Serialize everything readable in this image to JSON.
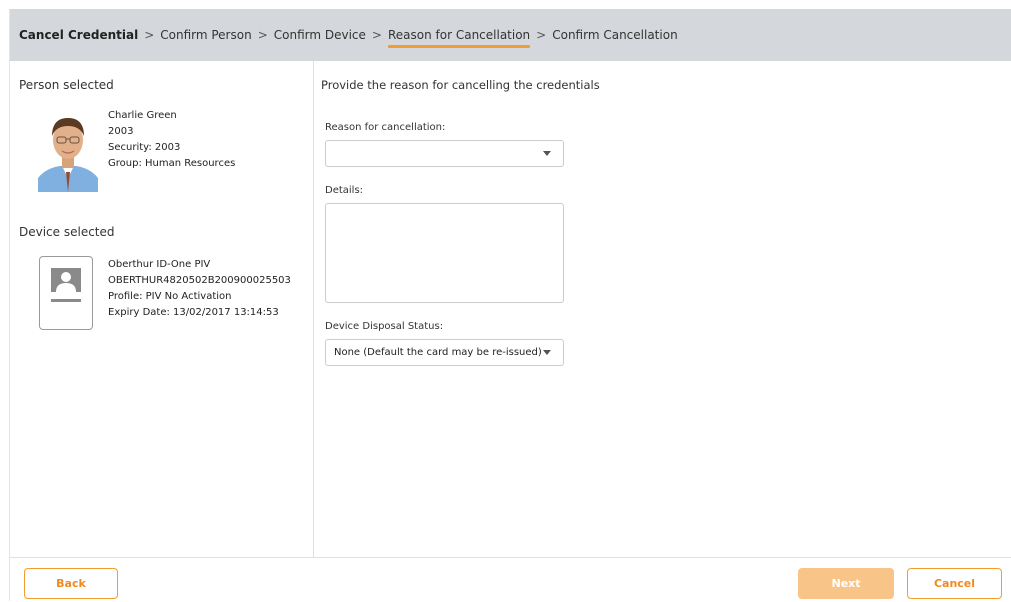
{
  "breadcrumb": {
    "items": [
      "Cancel Credential",
      "Confirm Person",
      "Confirm Device",
      "Reason for Cancellation",
      "Confirm Cancellation"
    ],
    "separator": ">",
    "active_index": 3
  },
  "person": {
    "section_title": "Person selected",
    "name": "Charlie Green",
    "id": "2003",
    "security": "Security: 2003",
    "group": "Group: Human Resources"
  },
  "device": {
    "section_title": "Device selected",
    "model": "Oberthur ID-One PIV",
    "serial": "OBERTHUR4820502B200900025503",
    "profile": "Profile: PIV No Activation",
    "expiry": "Expiry Date: 13/02/2017 13:14:53"
  },
  "form": {
    "heading": "Provide the reason for cancelling the credentials",
    "reason_label": "Reason for cancellation:",
    "reason_value": "",
    "details_label": "Details:",
    "details_value": "",
    "disposal_label": "Device Disposal Status:",
    "disposal_value": "None (Default the card may be re-issued)"
  },
  "footer": {
    "back_label": "Back",
    "next_label": "Next",
    "cancel_label": "Cancel"
  },
  "colors": {
    "accent": "#f39c32",
    "topbar_bg": "#d4d8dc",
    "next_disabled": "#f9c488"
  },
  "icons": {
    "dropdown": "chevron-down-icon",
    "device": "id-card-icon"
  }
}
